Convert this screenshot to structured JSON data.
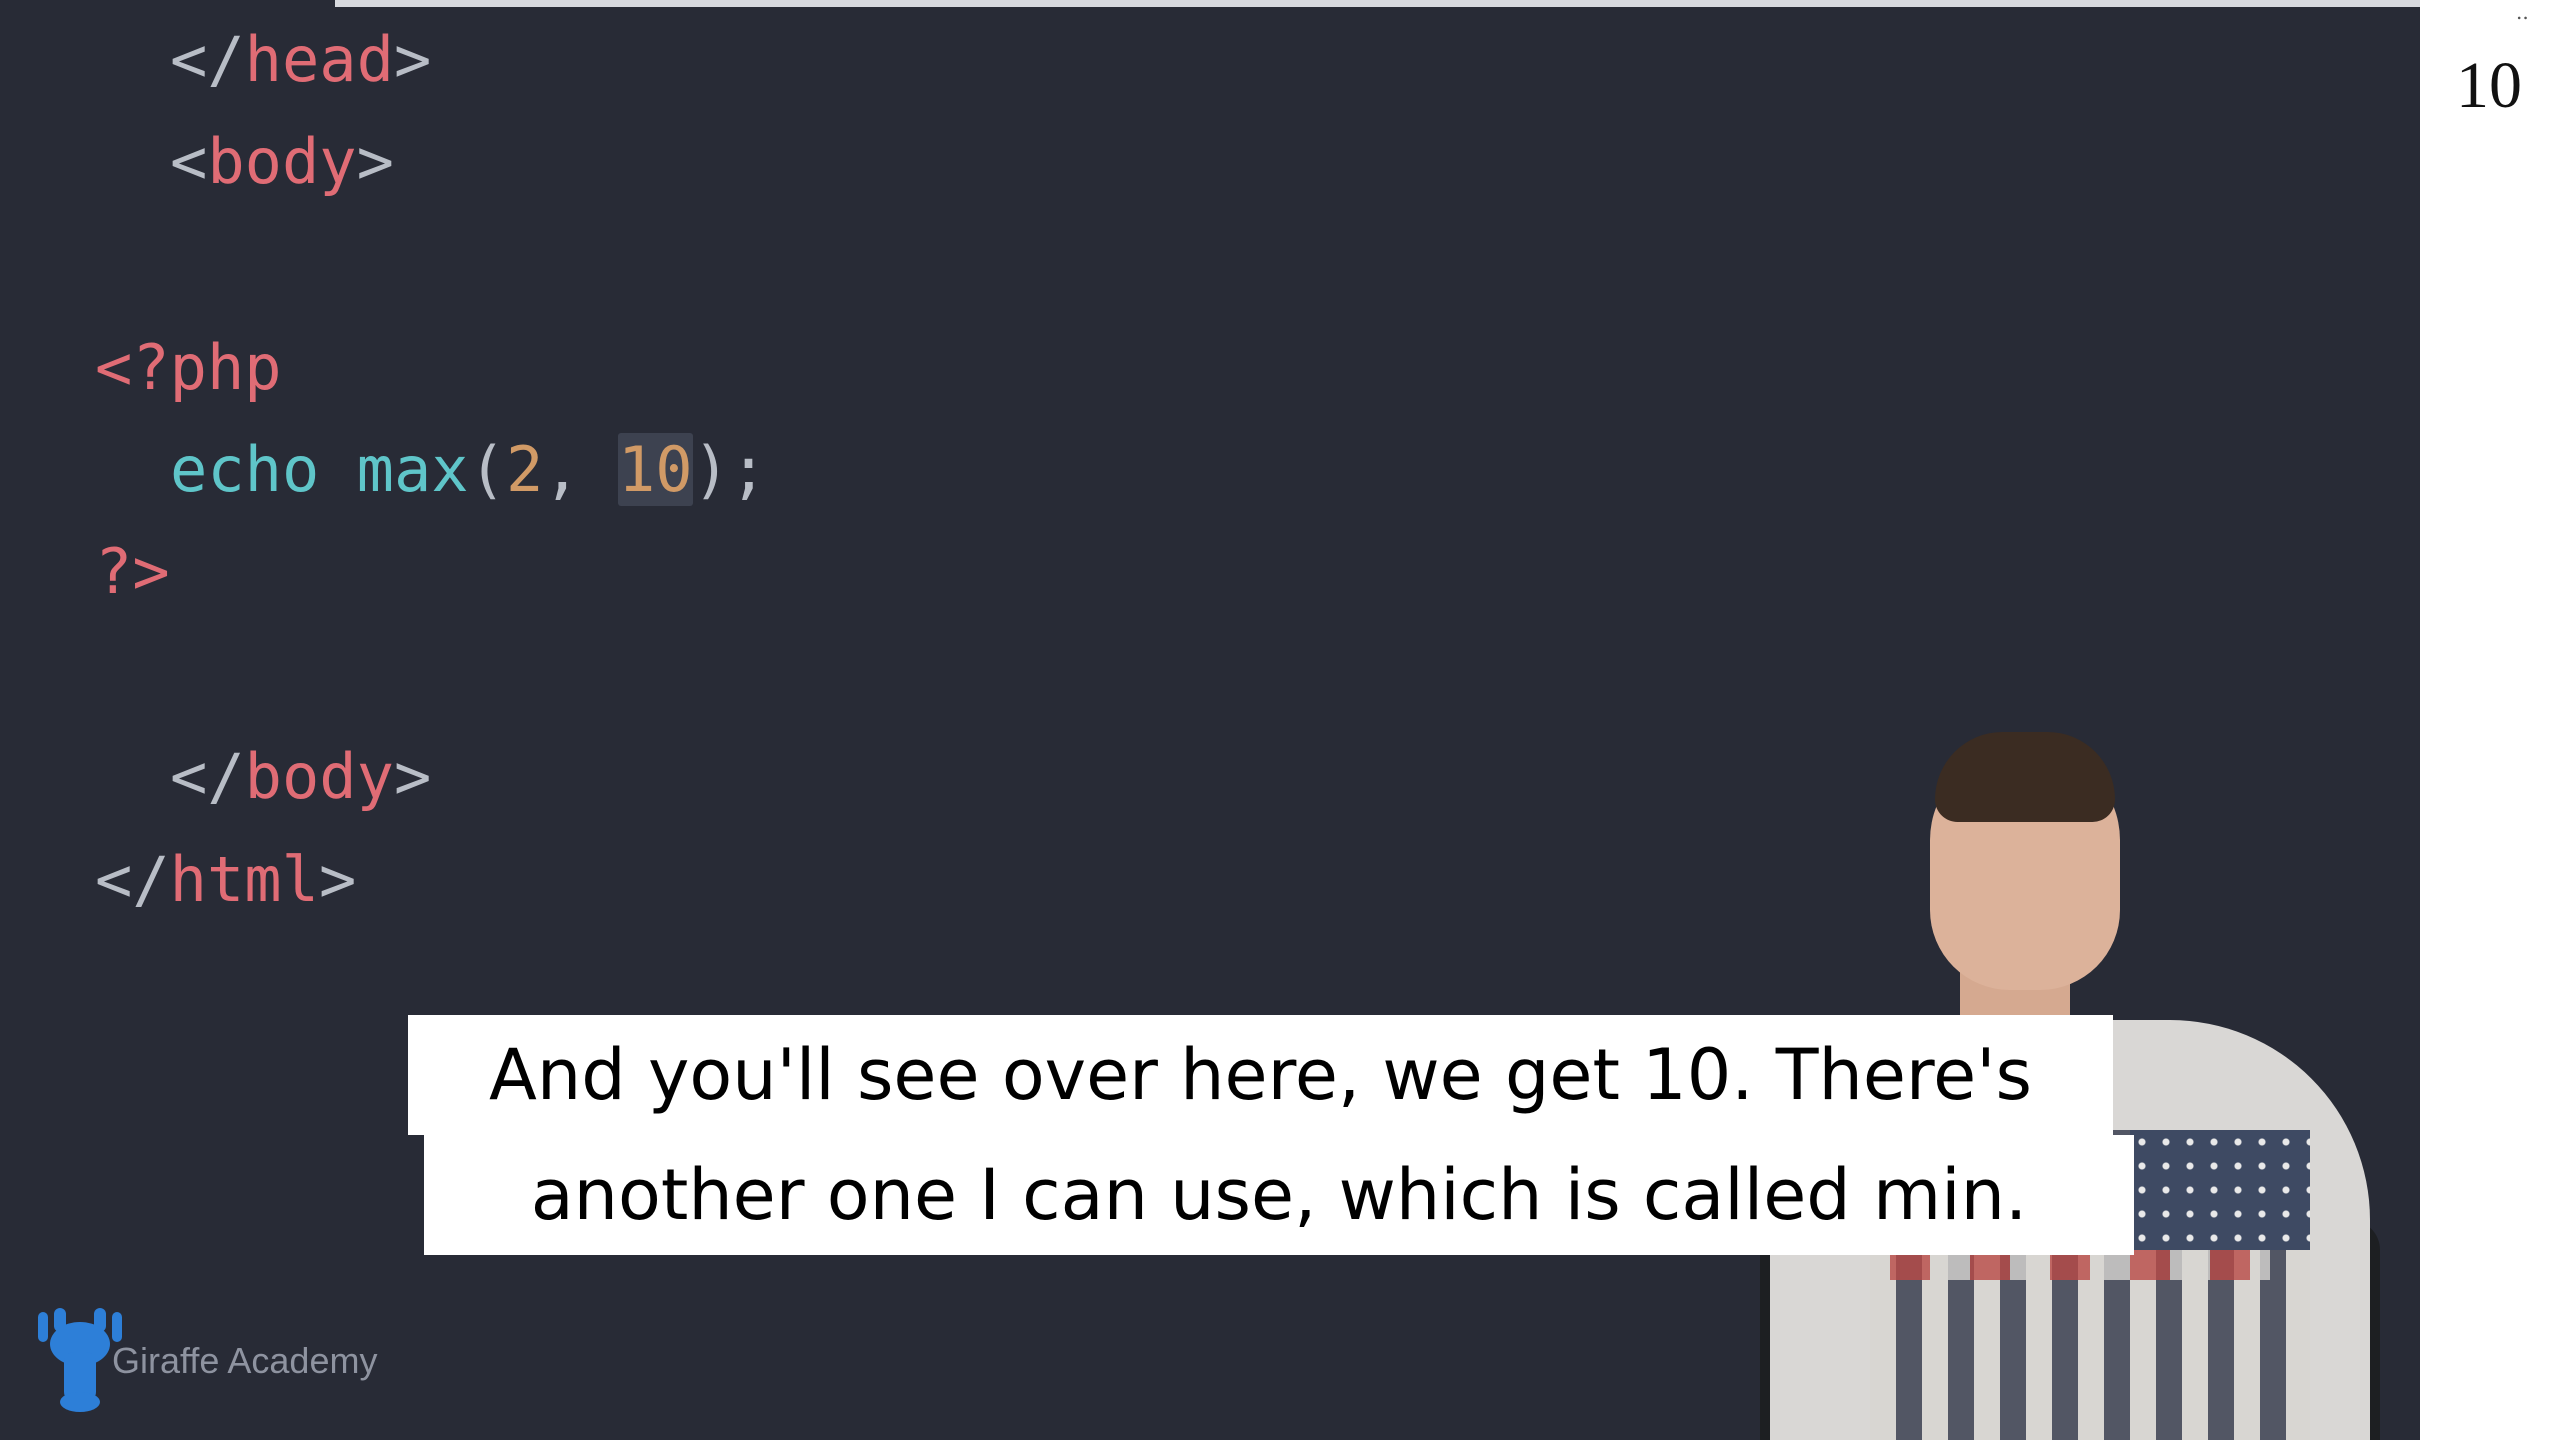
{
  "editor": {
    "lines": [
      {
        "id": "head-close",
        "tokens": [
          {
            "t": "</",
            "c": "punct"
          },
          {
            "t": "head",
            "c": "tag"
          },
          {
            "t": ">",
            "c": "punct"
          }
        ]
      },
      {
        "id": "body-open",
        "tokens": [
          {
            "t": "<",
            "c": "punct"
          },
          {
            "t": "body",
            "c": "tag"
          },
          {
            "t": ">",
            "c": "punct"
          }
        ]
      },
      {
        "id": "php-open",
        "tokens": [
          {
            "t": "<?php",
            "c": "php"
          }
        ]
      },
      {
        "id": "echo-max",
        "tokens": [
          {
            "t": "echo",
            "c": "fn"
          },
          {
            "t": " ",
            "c": "punct"
          },
          {
            "t": "max",
            "c": "fn"
          },
          {
            "t": "(",
            "c": "punct"
          },
          {
            "t": "2",
            "c": "num"
          },
          {
            "t": ", ",
            "c": "punct"
          },
          {
            "t": "10",
            "c": "num",
            "selected": true
          },
          {
            "t": ");",
            "c": "punct"
          }
        ]
      },
      {
        "id": "php-close",
        "tokens": [
          {
            "t": "?>",
            "c": "php"
          }
        ]
      },
      {
        "id": "body-close",
        "tokens": [
          {
            "t": "</",
            "c": "punct"
          },
          {
            "t": "body",
            "c": "tag"
          },
          {
            "t": ">",
            "c": "punct"
          }
        ]
      },
      {
        "id": "html-close",
        "tokens": [
          {
            "t": "</",
            "c": "punct"
          },
          {
            "t": "html",
            "c": "tag"
          },
          {
            "t": ">",
            "c": "punct"
          }
        ]
      }
    ]
  },
  "output": {
    "dots": "..",
    "value": "10"
  },
  "caption": {
    "line1": "And you'll see over here, we get 10. There's",
    "line2": "another one I can use, which is called min."
  },
  "logo": {
    "icon": "giraffe-icon",
    "text": "Giraffe Academy"
  },
  "colors": {
    "editor_bg": "#282b36",
    "tag": "#e06c75",
    "function": "#5fc5c9",
    "number": "#d19a66",
    "punctuation": "#b8bdc6",
    "logo_blue": "#2d7fd8"
  }
}
